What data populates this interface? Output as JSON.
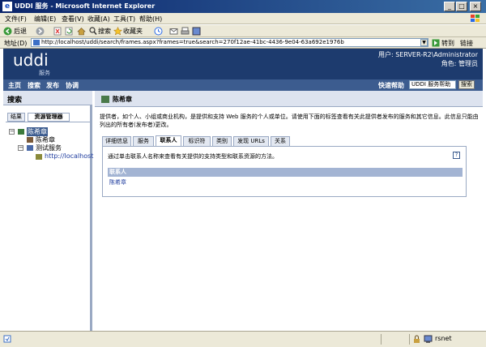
{
  "window": {
    "title": "UDDI 服务 - Microsoft Internet Explorer",
    "controls": [
      "_",
      "□",
      "×"
    ]
  },
  "menu": [
    "文件(F)",
    "编辑(E)",
    "查看(V)",
    "收藏(A)",
    "工具(T)",
    "帮助(H)"
  ],
  "toolbar": {
    "back": "后退",
    "search": "搜索",
    "favorites": "收藏夹"
  },
  "address": {
    "label": "地址(D)",
    "url": "http://localhost/uddi/search/frames.aspx?frames=true&search=270f12ae-41bc-4436-9e04-63a692e1976b",
    "go": "转到",
    "links": "链接"
  },
  "header": {
    "logo": "uddi",
    "logo_sub": "服务",
    "user": "用户: SERVER-R2\\Administrator",
    "role": "角色: 管理员"
  },
  "nav": {
    "items": [
      "主页",
      "搜索",
      "发布",
      "协调"
    ],
    "quick_help_label": "快速帮助",
    "quick_help_value": "UDDI 服务帮助",
    "search_button": "搜索"
  },
  "left": {
    "title": "搜索",
    "tabs": [
      "结果",
      "资源管理器"
    ],
    "tree": [
      "陈希章",
      "陈希章",
      "测试服务",
      "http://localhost"
    ]
  },
  "right": {
    "title": "陈希章",
    "description": "提供者，如个人、小组或商业机构，是提供和支持 Web 服务的个人或单位。请使用下面的标签查看有关此提供者发布的服务和其它信息。此信息只能由列出的所有者(发布者)更改。",
    "tabs": [
      "详细信息",
      "服务",
      "联系人",
      "标识符",
      "类别",
      "发现 URLs",
      "关系"
    ],
    "active_tab": 2,
    "panel_desc": "通过单击联系人名称来查看有关提供的支持类型和联系资源的方法。",
    "panel_help": "?",
    "column_header": "联系人",
    "contacts": [
      "陈希章"
    ]
  },
  "status": {
    "zone": "rsnet"
  },
  "colors": {
    "header_bg": "#1d3b6e",
    "nav_bg": "#3c5c8f",
    "pane_title_bg": "#dde3ef",
    "table_header_bg": "#a3b4d3"
  }
}
